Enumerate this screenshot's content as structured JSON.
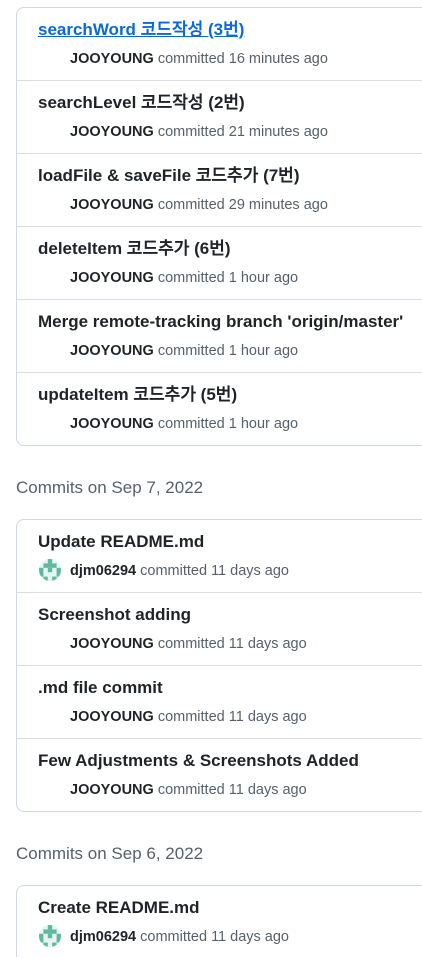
{
  "group_top": {
    "commits": [
      {
        "message": "searchWord 코드작성 (3번)",
        "author": "JOOYOUNG",
        "verb": "committed",
        "time": "16 minutes ago",
        "link": true
      },
      {
        "message": "searchLevel 코드작성 (2번)",
        "author": "JOOYOUNG",
        "verb": "committed",
        "time": "21 minutes ago"
      },
      {
        "message": "loadFile & saveFile 코드추가 (7번)",
        "author": "JOOYOUNG",
        "verb": "committed",
        "time": "29 minutes ago"
      },
      {
        "message": "deleteItem 코드추가 (6번)",
        "author": "JOOYOUNG",
        "verb": "committed",
        "time": "1 hour ago"
      },
      {
        "message": "Merge remote-tracking branch 'origin/master'",
        "author": "JOOYOUNG",
        "verb": "committed",
        "time": "1 hour ago"
      },
      {
        "message": "updateItem 코드추가 (5번)",
        "author": "JOOYOUNG",
        "verb": "committed",
        "time": "1 hour ago"
      }
    ]
  },
  "group_sep7": {
    "header": "Commits on Sep 7, 2022",
    "commits": [
      {
        "message": "Update README.md",
        "author": "djm06294",
        "verb": "committed",
        "time": "11 days ago",
        "avatar": true
      },
      {
        "message": "Screenshot adding",
        "author": "JOOYOUNG",
        "verb": "committed",
        "time": "11 days ago"
      },
      {
        "message": ".md file commit",
        "author": "JOOYOUNG",
        "verb": "committed",
        "time": "11 days ago"
      },
      {
        "message": "Few Adjustments & Screenshots Added",
        "author": "JOOYOUNG",
        "verb": "committed",
        "time": "11 days ago"
      }
    ]
  },
  "group_sep6": {
    "header": "Commits on Sep 6, 2022",
    "commits": [
      {
        "message": "Create README.md",
        "author": "djm06294",
        "verb": "committed",
        "time": "11 days ago",
        "avatar": true
      }
    ]
  },
  "colors": {
    "link": "#0969da",
    "muted": "#57606a",
    "border": "#d0d7de",
    "avatar_bg": "#c6ede3",
    "avatar_fg": "#5fb8a0"
  }
}
